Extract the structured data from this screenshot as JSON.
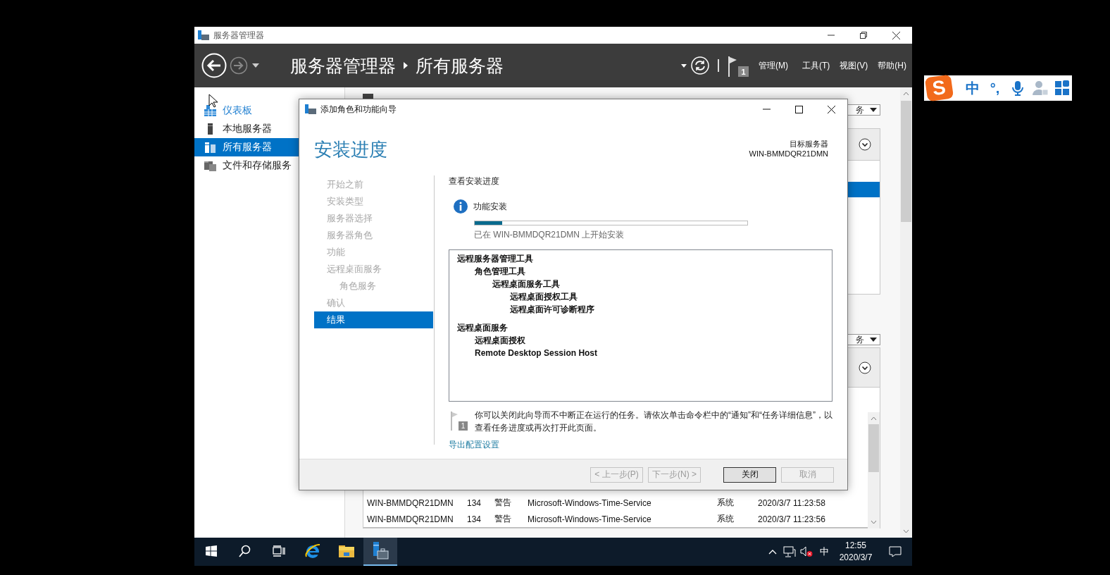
{
  "window": {
    "title": "服务器管理器"
  },
  "header": {
    "breadcrumb": [
      "服务器管理器",
      "所有服务器"
    ],
    "notifications": "1",
    "menus": [
      "管理(M)",
      "工具(T)",
      "视图(V)",
      "帮助(H)"
    ]
  },
  "sidebar": {
    "items": [
      {
        "label": "仪表板",
        "kind": "dashboard",
        "selected": false,
        "hovered": true
      },
      {
        "label": "本地服务器",
        "kind": "server",
        "selected": false,
        "hovered": false
      },
      {
        "label": "所有服务器",
        "kind": "servers",
        "selected": true,
        "hovered": false
      },
      {
        "label": "文件和存储服务",
        "kind": "storage",
        "selected": false,
        "hovered": false
      }
    ]
  },
  "panels": [
    {
      "dropdown": "务"
    },
    {
      "dropdown": "务",
      "rows": [
        [
          "WIN-BMMDQR21DMN",
          "134",
          "警告",
          "Microsoft-Windows-Time-Service",
          "系统",
          "2020/3/7 11:23:58"
        ],
        [
          "WIN-BMMDQR21DMN",
          "134",
          "警告",
          "Microsoft-Windows-Time-Service",
          "系统",
          "2020/3/7 11:23:56"
        ]
      ]
    }
  ],
  "dialog": {
    "title": "添加角色和功能向导",
    "heading": "安装进度",
    "target_label": "目标服务器",
    "target_server": "WIN-BMMDQR21DMN",
    "steps": [
      {
        "label": "开始之前",
        "selected": false
      },
      {
        "label": "安装类型",
        "selected": false
      },
      {
        "label": "服务器选择",
        "selected": false
      },
      {
        "label": "服务器角色",
        "selected": false
      },
      {
        "label": "功能",
        "selected": false
      },
      {
        "label": "远程桌面服务",
        "selected": false,
        "children": [
          {
            "label": "角色服务",
            "selected": false
          }
        ]
      },
      {
        "label": "确认",
        "selected": false
      },
      {
        "label": "结果",
        "selected": true
      }
    ],
    "section_title": "查看安装进度",
    "progress": {
      "title": "功能安装",
      "level": 0.1,
      "status": "已在 WIN-BMMDQR21DMN 上开始安装"
    },
    "results": [
      {
        "label": "远程服务器管理工具",
        "children": [
          {
            "label": "角色管理工具",
            "children": [
              {
                "label": "远程桌面服务工具",
                "children": [
                  {
                    "label": "远程桌面授权工具"
                  },
                  {
                    "label": "远程桌面许可诊断程序"
                  }
                ]
              }
            ]
          }
        ]
      },
      {
        "label": "远程桌面服务",
        "children": [
          {
            "label": "远程桌面授权"
          },
          {
            "label": "Remote Desktop Session Host"
          }
        ]
      }
    ],
    "note": {
      "badge": "1",
      "text": "你可以关闭此向导而不中断正在运行的任务。请依次单击命令栏中的“通知”和“任务详细信息”，以查看任务进度或再次打开此页面。"
    },
    "link": "导出配置设置",
    "buttons": [
      {
        "label": "< 上一步(P)",
        "disabled": true,
        "default": false
      },
      {
        "label": "下一步(N) >",
        "disabled": true,
        "default": false
      },
      {
        "label": "关闭",
        "disabled": false,
        "default": true
      },
      {
        "label": "取消",
        "disabled": true,
        "default": false
      }
    ]
  },
  "taskbar": {
    "apps": [
      {
        "kind": "start",
        "selected": false
      },
      {
        "kind": "search",
        "selected": false
      },
      {
        "kind": "taskview",
        "selected": false
      },
      {
        "kind": "browser",
        "selected": false
      },
      {
        "kind": "explorer",
        "selected": false
      },
      {
        "kind": "servermanager",
        "selected": true
      }
    ],
    "tray": {
      "ime": "中",
      "time": "12:55",
      "date": "2020/3/7"
    }
  },
  "ime_bar": {
    "logo": "S",
    "mode": "中",
    "punct": "°,"
  }
}
